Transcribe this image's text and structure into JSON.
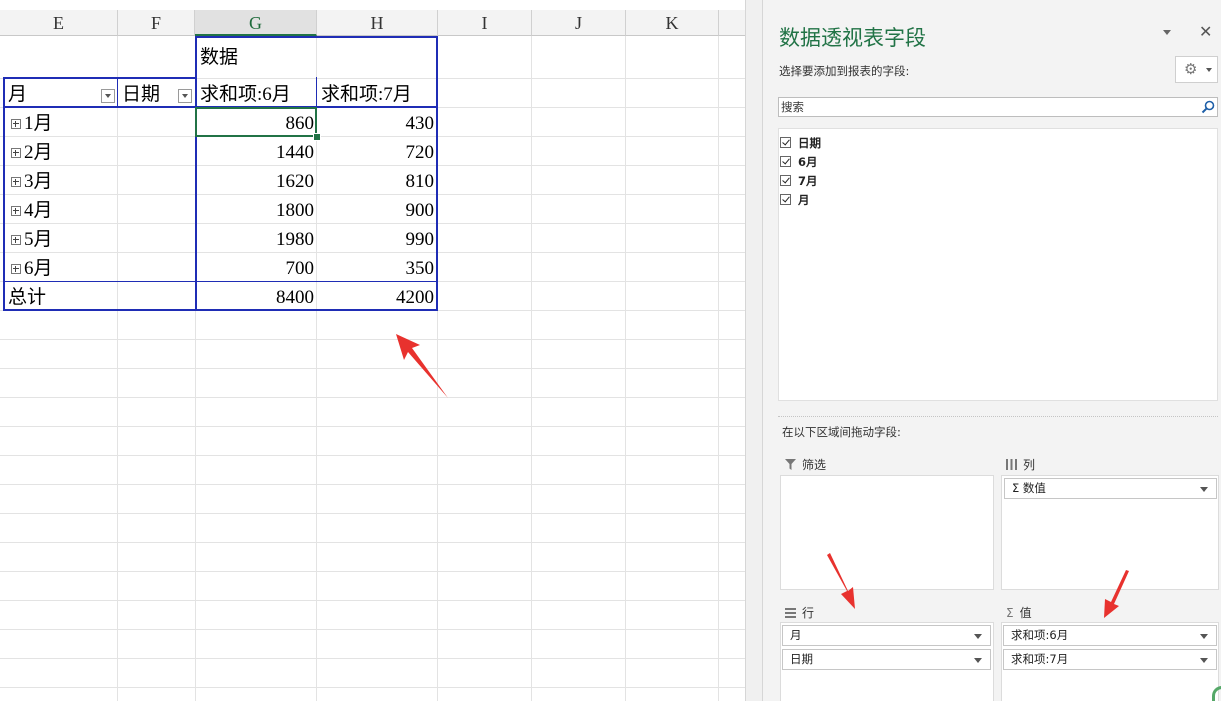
{
  "sheet": {
    "columns": [
      {
        "label": "E",
        "selected": false
      },
      {
        "label": "F",
        "selected": false
      },
      {
        "label": "G",
        "selected": true
      },
      {
        "label": "H",
        "selected": false
      },
      {
        "label": "I",
        "selected": false
      },
      {
        "label": "J",
        "selected": false
      },
      {
        "label": "K",
        "selected": false
      }
    ],
    "pivot": {
      "data_header": "数据",
      "row_header_1": "月",
      "row_header_2": "日期",
      "value_header_1": "求和项:6月",
      "value_header_2": "求和项:7月",
      "rows": [
        {
          "label": "1月",
          "v6": "860",
          "v7": "430"
        },
        {
          "label": "2月",
          "v6": "1440",
          "v7": "720"
        },
        {
          "label": "3月",
          "v6": "1620",
          "v7": "810"
        },
        {
          "label": "4月",
          "v6": "1800",
          "v7": "900"
        },
        {
          "label": "5月",
          "v6": "1980",
          "v7": "990"
        },
        {
          "label": "6月",
          "v6": "700",
          "v7": "350"
        }
      ],
      "total": {
        "label": "总计",
        "v6": "8400",
        "v7": "4200"
      }
    }
  },
  "pane": {
    "title": "数据透视表字段",
    "choose_label": "选择要添加到报表的字段:",
    "search_placeholder": "搜索",
    "fields": [
      {
        "label": "日期",
        "checked": true
      },
      {
        "label": "6月",
        "checked": true
      },
      {
        "label": "7月",
        "checked": true
      },
      {
        "label": "月",
        "checked": true
      }
    ],
    "drag_label": "在以下区域间拖动字段:",
    "areas": {
      "filter": {
        "label": "筛选",
        "icon": "filter-icon",
        "items": []
      },
      "columns": {
        "label": "列",
        "icon": "columns-icon",
        "items": [
          "Σ 数值"
        ]
      },
      "rows": {
        "label": "行",
        "icon": "rows-icon",
        "items": [
          "月",
          "日期"
        ]
      },
      "values": {
        "label": "值",
        "icon": "sigma-icon",
        "items": [
          "求和项:6月",
          "求和项:7月"
        ]
      }
    }
  },
  "annotations": {
    "arrow_color": "#e8322e"
  }
}
